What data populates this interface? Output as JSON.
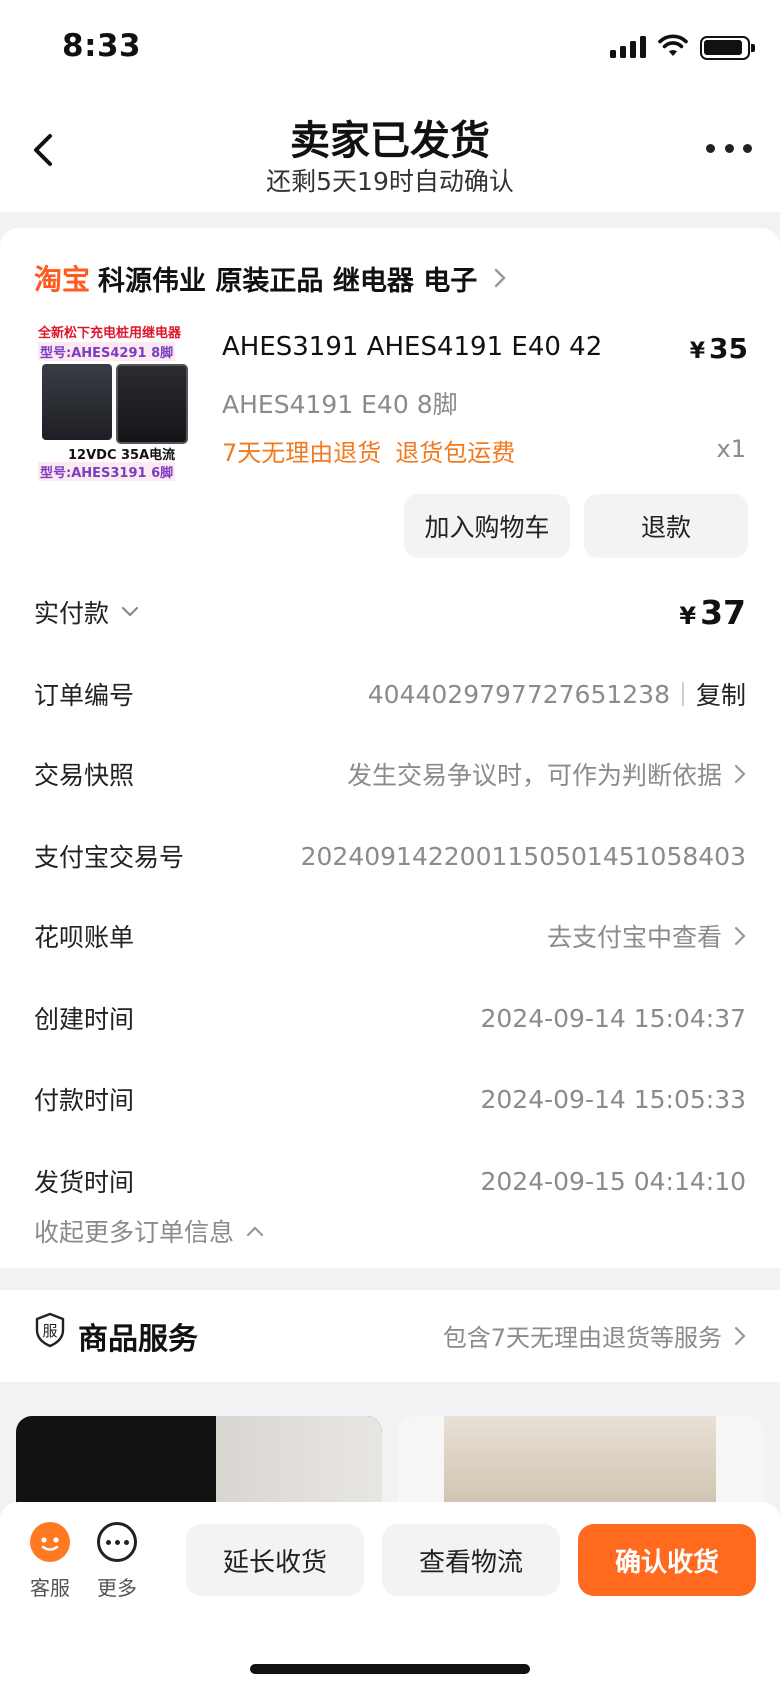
{
  "status_bar": {
    "time": "8:33"
  },
  "header": {
    "title": "卖家已发货",
    "subtitle": "还剩5天19时自动确认"
  },
  "order": {
    "shop_brand": "淘宝",
    "shop_name": "科源伟业 原装正品 继电器 电子",
    "product": {
      "thumb_text": {
        "line1": "全新松下充电桩用继电器",
        "line2": "型号:AHES4291 8脚",
        "spec": "12VDC 35A电流",
        "line3": "型号:AHES3191 6脚"
      },
      "title": "AHES3191 AHES4191 E40 42",
      "price_symbol": "¥",
      "price": "35",
      "sku": "AHES4191 E40 8脚",
      "tags": [
        "7天无理由退货",
        "退货包运费"
      ],
      "qty": "x1"
    },
    "buttons": {
      "add_to_cart": "加入购物车",
      "refund": "退款"
    },
    "info": {
      "paid_label": "实付款",
      "paid_symbol": "¥",
      "paid_amount": "37",
      "order_no_label": "订单编号",
      "order_no": "4044029797727651238",
      "copy": "复制",
      "snapshot_label": "交易快照",
      "snapshot_value": "发生交易争议时，可作为判断依据",
      "alipay_no_label": "支付宝交易号",
      "alipay_no": "2024091422001150501451058403",
      "huabei_label": "花呗账单",
      "huabei_value": "去支付宝中查看",
      "created_label": "创建时间",
      "created_time": "2024-09-14 15:04:37",
      "paid_time_label": "付款时间",
      "paid_time": "2024-09-14 15:05:33",
      "shipped_label": "发货时间",
      "shipped_time": "2024-09-15 04:14:10",
      "collapse": "收起更多订单信息"
    }
  },
  "service": {
    "icon_char": "服",
    "title": "商品服务",
    "desc": "包含7天无理由退货等服务"
  },
  "bottom_bar": {
    "customer_service": "客服",
    "more": "更多",
    "extend": "延长收货",
    "logistics": "查看物流",
    "confirm": "确认收货"
  },
  "colors": {
    "accent": "#ff6a1e",
    "brand": "#ff5a1f",
    "tag": "#f07a20"
  }
}
